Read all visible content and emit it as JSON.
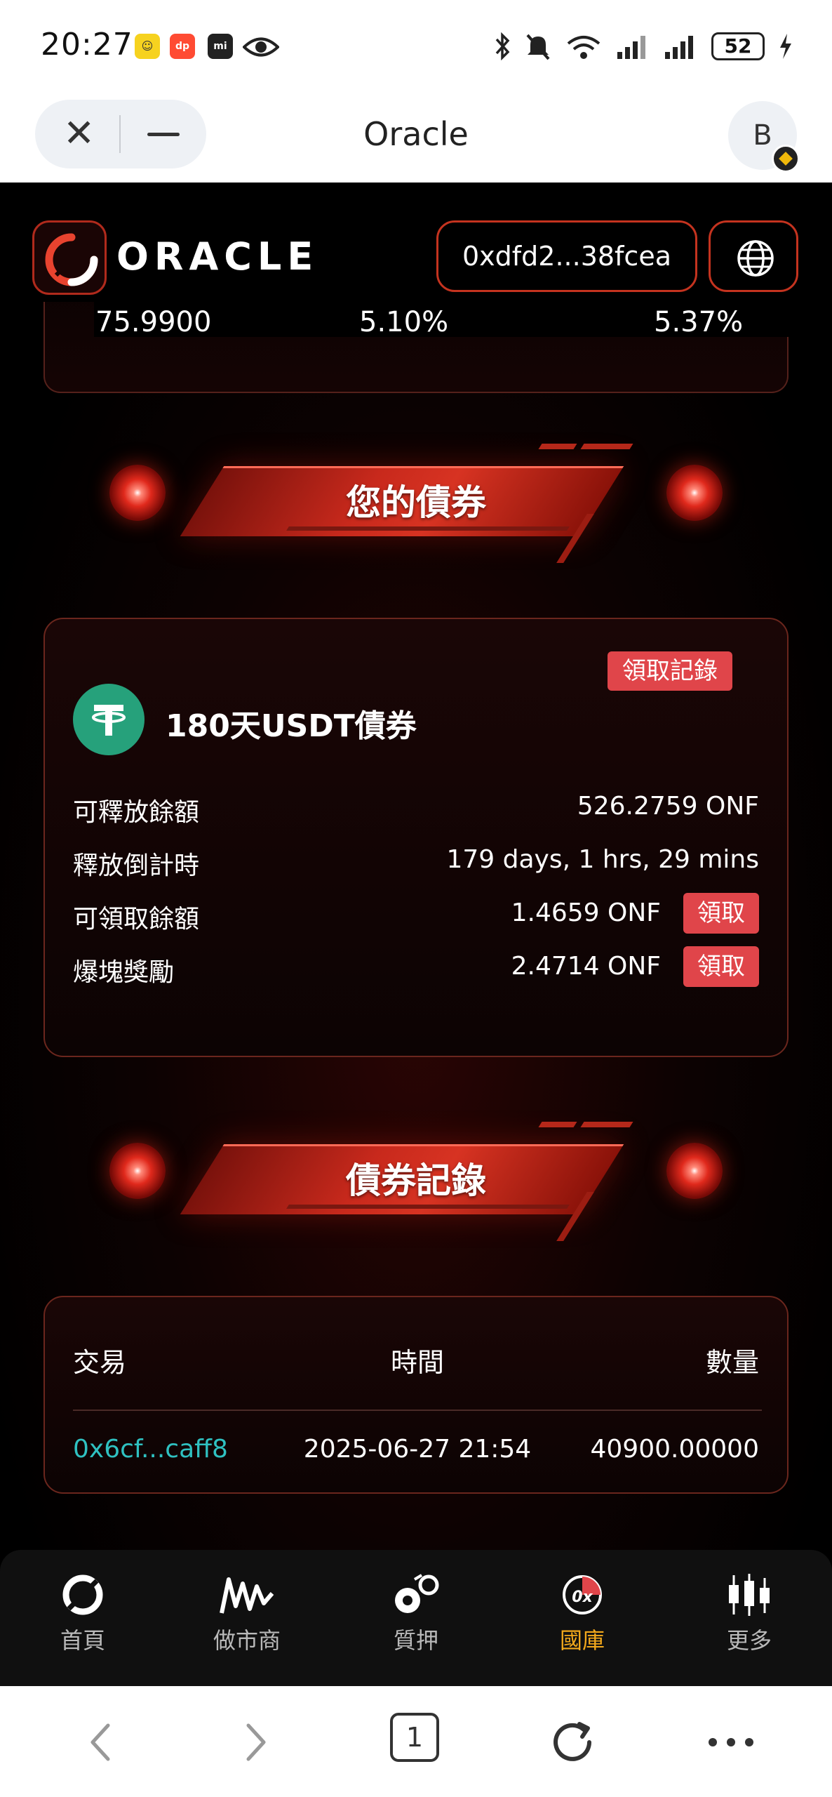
{
  "status_bar": {
    "time": "20:27",
    "battery": "52",
    "icons": [
      "notification-app-icon",
      "dianping-icon",
      "mi-icon",
      "eye-icon",
      "bluetooth-icon",
      "mute-icon",
      "wifi-icon",
      "signal-icon",
      "signal-icon",
      "battery-icon",
      "charging-icon"
    ]
  },
  "browser": {
    "title": "Oracle",
    "profile_initial": "B",
    "tab_count": "1"
  },
  "app": {
    "logo_text": "ORACLE",
    "wallet_address": "0xdfd2...38fcea"
  },
  "top_card": {
    "values": [
      "75.9900",
      "5.10%",
      "5.37%"
    ]
  },
  "your_bonds": {
    "title": "您的債券",
    "records_button": "領取記錄",
    "bond_name": "180天USDT債券",
    "rows": [
      {
        "label": "可釋放餘額",
        "value": "526.2759 ONF"
      },
      {
        "label": "釋放倒計時",
        "value": "179 days, 1 hrs, 29 mins"
      },
      {
        "label": "可領取餘額",
        "value": "1.4659 ONF",
        "button": "領取"
      },
      {
        "label": "爆塊獎勵",
        "value": "2.4714 ONF",
        "button": "領取"
      }
    ]
  },
  "bond_records": {
    "title": "債券記錄",
    "columns": [
      "交易",
      "時間",
      "數量"
    ],
    "rows": [
      {
        "tx": "0x6cf...caff8",
        "time": "2025-06-27 21:54",
        "amount": "40900.00000"
      }
    ]
  },
  "bottom_nav": {
    "items": [
      {
        "label": "首頁",
        "icon": "home-logo-icon"
      },
      {
        "label": "做市商",
        "icon": "market-maker-icon"
      },
      {
        "label": "質押",
        "icon": "staking-icon"
      },
      {
        "label": "國庫",
        "icon": "treasury-icon",
        "active": true
      },
      {
        "label": "更多",
        "icon": "more-candles-icon"
      }
    ],
    "active_color": "#f3a91c"
  },
  "colors": {
    "accent_red": "#e0454a",
    "border_red": "#c4331f",
    "link_teal": "#2fc1c1",
    "usdt_green": "#26a17b"
  }
}
